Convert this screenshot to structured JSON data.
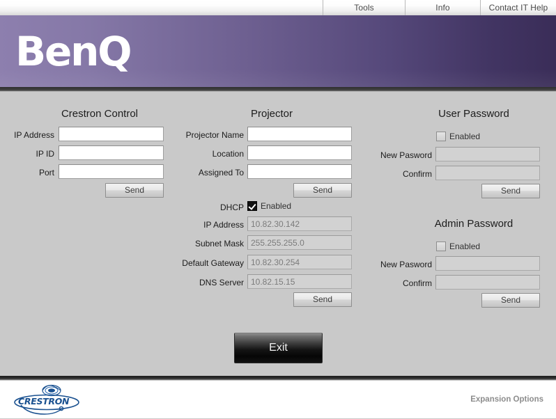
{
  "topnav": {
    "items": [
      {
        "label": "Tools",
        "name": "nav-tools"
      },
      {
        "label": "Info",
        "name": "nav-info"
      },
      {
        "label": "Contact IT Help",
        "name": "nav-contact-it-help"
      }
    ]
  },
  "banner": {
    "brand": "BenQ",
    "gradient_from": "#8d7fae",
    "gradient_to": "#3a2d58"
  },
  "crestron_control": {
    "title": "Crestron Control",
    "fields": [
      {
        "label": "IP Address",
        "value": "",
        "placeholder": ""
      },
      {
        "label": "IP ID",
        "value": "",
        "placeholder": ""
      },
      {
        "label": "Port",
        "value": "",
        "placeholder": ""
      }
    ],
    "send_label": "Send"
  },
  "projector": {
    "title": "Projector",
    "fields": [
      {
        "label": "Projector Name",
        "value": "",
        "placeholder": ""
      },
      {
        "label": "Location",
        "value": "",
        "placeholder": ""
      },
      {
        "label": "Assigned To",
        "value": "",
        "placeholder": ""
      }
    ],
    "send_label": "Send",
    "dhcp": {
      "label": "DHCP",
      "checkbox_label": "Enabled",
      "checked": true
    },
    "network_fields": [
      {
        "label": "IP Address",
        "value": "10.82.30.142"
      },
      {
        "label": "Subnet Mask",
        "value": "255.255.255.0"
      },
      {
        "label": "Default Gateway",
        "value": "10.82.30.254"
      },
      {
        "label": "DNS Server",
        "value": "10.82.15.15"
      }
    ],
    "network_send_label": "Send"
  },
  "user_password": {
    "title": "User Password",
    "checkbox_label": "Enabled",
    "checked": false,
    "fields": [
      {
        "label": "New Pasword",
        "value": ""
      },
      {
        "label": "Confirm",
        "value": ""
      }
    ],
    "send_label": "Send"
  },
  "admin_password": {
    "title": "Admin Password",
    "checkbox_label": "Enabled",
    "checked": false,
    "fields": [
      {
        "label": "New Pasword",
        "value": ""
      },
      {
        "label": "Confirm",
        "value": ""
      }
    ],
    "send_label": "Send"
  },
  "exit_button": {
    "label": "Exit"
  },
  "footer": {
    "logo_text": "CRESTRON",
    "logo_color": "#1a5190",
    "expansion_options": "Expansion Options"
  }
}
